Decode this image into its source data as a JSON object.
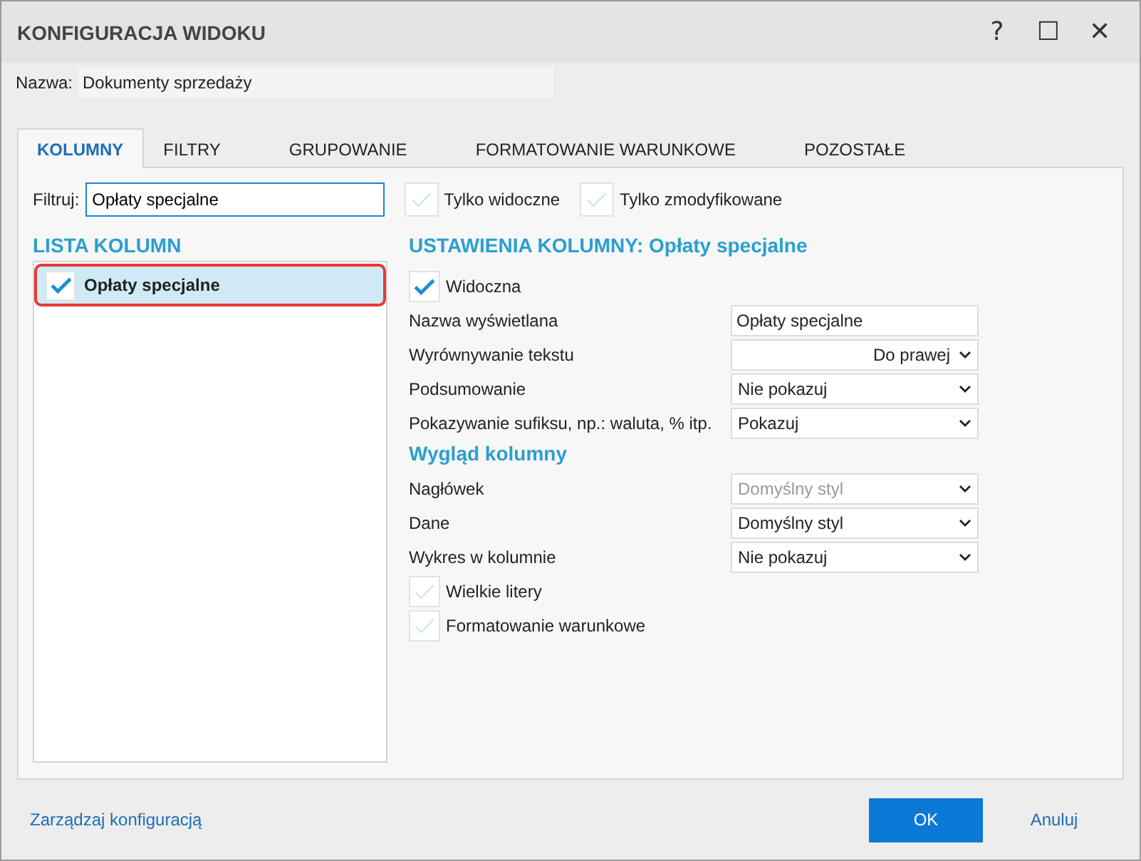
{
  "window": {
    "title": "KONFIGURACJA WIDOKU",
    "controls": [
      "?",
      "☐",
      "✕"
    ]
  },
  "name_field": {
    "label": "Nazwa:",
    "value": "Dokumenty sprzedaży"
  },
  "tabs": [
    {
      "label": "KOLUMNY",
      "selected": true
    },
    {
      "label": "FILTRY",
      "selected": false
    },
    {
      "label": "GRUPOWANIE",
      "selected": false
    },
    {
      "label": "FORMATOWANIE WARUNKOWE",
      "selected": false
    },
    {
      "label": "POZOSTAŁE",
      "selected": false
    }
  ],
  "filter": {
    "label": "Filtruj:",
    "value": "Opłaty specjalne",
    "options": [
      {
        "label": "Tylko widoczne",
        "checked": false
      },
      {
        "label": "Tylko zmodyfikowane",
        "checked": false
      }
    ]
  },
  "column_list": {
    "title": "LISTA KOLUMN",
    "items": [
      {
        "label": "Opłaty specjalne",
        "checked": true,
        "selected": true
      }
    ]
  },
  "settings": {
    "title": "USTAWIENIA KOLUMNY: Opłaty specjalne",
    "rows": [
      {
        "kind": "checkbox",
        "label": "Widoczna",
        "checked": true
      },
      {
        "kind": "text",
        "label": "Nazwa wyświetlana",
        "value": "Opłaty specjalne"
      },
      {
        "kind": "select",
        "label": "Wyrównywanie tekstu",
        "value": "Do prawej",
        "right_aligned": true,
        "disabled": false
      },
      {
        "kind": "select",
        "label": "Podsumowanie",
        "value": "Nie pokazuj",
        "right_aligned": false,
        "disabled": false
      },
      {
        "kind": "select",
        "label": "Pokazywanie sufiksu, np.: waluta, % itp.",
        "value": "Pokazuj",
        "right_aligned": false,
        "disabled": false
      },
      {
        "kind": "heading",
        "label": "Wygląd kolumny"
      },
      {
        "kind": "select",
        "label": "Nagłówek",
        "value": "Domyślny styl",
        "right_aligned": false,
        "disabled": true
      },
      {
        "kind": "select",
        "label": "Dane",
        "value": "Domyślny styl",
        "right_aligned": false,
        "disabled": false
      },
      {
        "kind": "select",
        "label": "Wykres w kolumnie",
        "value": "Nie pokazuj",
        "right_aligned": false,
        "disabled": false
      },
      {
        "kind": "checkbox",
        "label": "Wielkie litery",
        "checked": false
      },
      {
        "kind": "checkbox",
        "label": "Formatowanie warunkowe",
        "checked": false
      }
    ]
  },
  "footer": {
    "link": "Zarządzaj konfiguracją",
    "buttons": [
      {
        "label": "OK",
        "kind": "primary"
      },
      {
        "label": "Anuluj",
        "kind": "link"
      }
    ]
  }
}
